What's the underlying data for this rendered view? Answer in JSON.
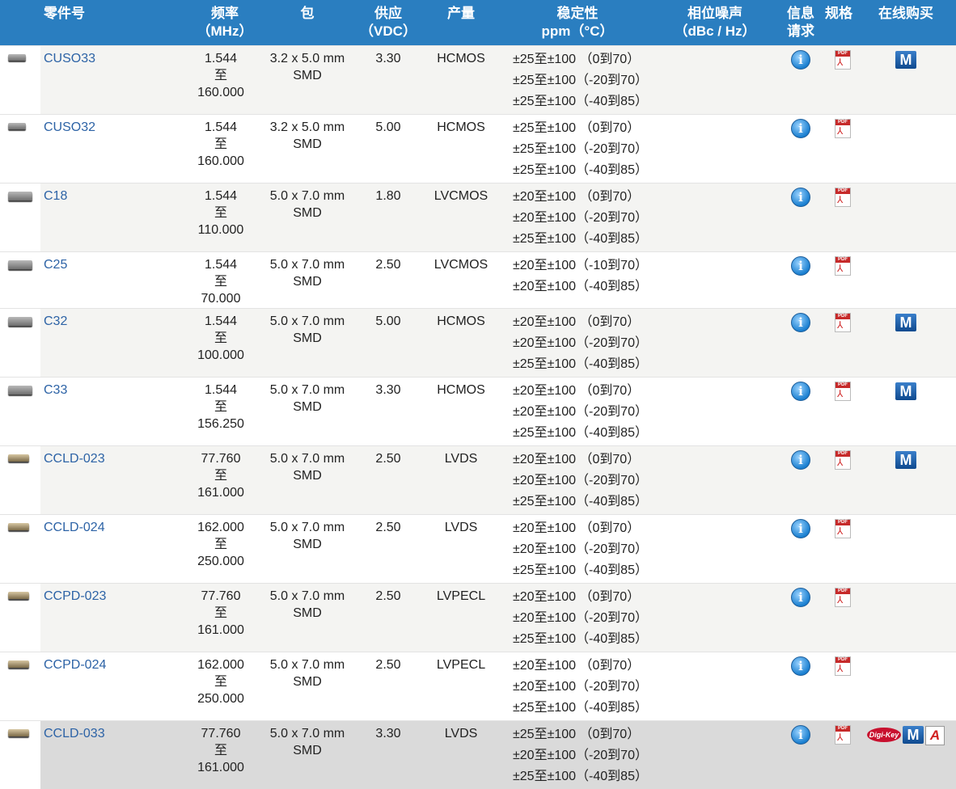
{
  "headers": {
    "part": "零件号",
    "freq_l1": "频率",
    "freq_l2": "（MHz）",
    "package": "包",
    "supply_l1": "供应",
    "supply_l2": "（VDC）",
    "output": "产量",
    "stab_l1": "稳定性",
    "stab_l2": "ppm（°C）",
    "noise_l1": "相位噪声",
    "noise_l2": "（dBc / Hz）",
    "info_l1": "信息",
    "info_l2": "请求",
    "spec": "规格",
    "buy": "在线购买"
  },
  "icons": {
    "info": "info-icon",
    "pdf": "pdf-icon",
    "mouser": "mouser-logo",
    "digikey": "digikey-logo",
    "arrow": "arrow-logo"
  },
  "labels": {
    "info_glyph": "i",
    "pdf_band": "PDF",
    "mouser_glyph": "M",
    "digikey_text": "Digi-Key",
    "arrow_glyph": "A"
  },
  "colors": {
    "header_bg": "#2a7ec0",
    "link": "#2d63a6",
    "row_shade": "#f4f4f2",
    "row_highlight": "#dadada"
  },
  "rows": [
    {
      "part": "CUSO33",
      "freq": [
        "1.544",
        "至",
        "160.000"
      ],
      "package": [
        "3.2 x 5.0 mm",
        "SMD"
      ],
      "supply": "3.30",
      "output": "HCMOS",
      "stability": [
        "±25至±100 （0到70）",
        "±25至±100（-20到70）",
        "±25至±100（-40到85）"
      ],
      "buy": [
        "mouser"
      ]
    },
    {
      "part": "CUSO32",
      "freq": [
        "1.544",
        "至",
        "160.000"
      ],
      "package": [
        "3.2 x 5.0 mm",
        "SMD"
      ],
      "supply": "5.00",
      "output": "HCMOS",
      "stability": [
        "±25至±100 （0到70）",
        "±25至±100（-20到70）",
        "±25至±100（-40到85）"
      ],
      "buy": []
    },
    {
      "part": "C18",
      "freq": [
        "1.544",
        "至",
        "110.000"
      ],
      "package": [
        "5.0 x 7.0 mm",
        "SMD"
      ],
      "supply": "1.80",
      "output": "LVCMOS",
      "stability": [
        "±20至±100 （0到70）",
        "±20至±100（-20到70）",
        "±25至±100（-40到85）"
      ],
      "buy": []
    },
    {
      "part": "C25",
      "freq": [
        "1.544",
        "至",
        "70.000"
      ],
      "package": [
        "5.0 x 7.0 mm",
        "SMD"
      ],
      "supply": "2.50",
      "output": "LVCMOS",
      "stability": [
        "±20至±100（-10到70）",
        "±20至±100（-40到85）"
      ],
      "buy": []
    },
    {
      "part": "C32",
      "freq": [
        "1.544",
        "至",
        "100.000"
      ],
      "package": [
        "5.0 x 7.0 mm",
        "SMD"
      ],
      "supply": "5.00",
      "output": "HCMOS",
      "stability": [
        "±20至±100 （0到70）",
        "±20至±100（-20到70）",
        "±25至±100（-40到85）"
      ],
      "buy": [
        "mouser"
      ]
    },
    {
      "part": "C33",
      "freq": [
        "1.544",
        "至",
        "156.250"
      ],
      "package": [
        "5.0 x 7.0 mm",
        "SMD"
      ],
      "supply": "3.30",
      "output": "HCMOS",
      "stability": [
        "±20至±100 （0到70）",
        "±20至±100（-20到70）",
        "±25至±100（-40到85）"
      ],
      "buy": [
        "mouser"
      ]
    },
    {
      "part": "CCLD-023",
      "freq": [
        "77.760",
        "至",
        "161.000"
      ],
      "package": [
        "5.0 x 7.0 mm",
        "SMD"
      ],
      "supply": "2.50",
      "output": "LVDS",
      "stability": [
        "±20至±100 （0到70）",
        "±20至±100（-20到70）",
        "±25至±100（-40到85）"
      ],
      "buy": [
        "mouser"
      ]
    },
    {
      "part": "CCLD-024",
      "freq": [
        "162.000",
        "至",
        "250.000"
      ],
      "package": [
        "5.0 x 7.0 mm",
        "SMD"
      ],
      "supply": "2.50",
      "output": "LVDS",
      "stability": [
        "±20至±100 （0到70）",
        "±20至±100（-20到70）",
        "±25至±100（-40到85）"
      ],
      "buy": []
    },
    {
      "part": "CCPD-023",
      "freq": [
        "77.760",
        "至",
        "161.000"
      ],
      "package": [
        "5.0 x 7.0 mm",
        "SMD"
      ],
      "supply": "2.50",
      "output": "LVPECL",
      "stability": [
        "±20至±100 （0到70）",
        "±20至±100（-20到70）",
        "±25至±100（-40到85）"
      ],
      "buy": []
    },
    {
      "part": "CCPD-024",
      "freq": [
        "162.000",
        "至",
        "250.000"
      ],
      "package": [
        "5.0 x 7.0 mm",
        "SMD"
      ],
      "supply": "2.50",
      "output": "LVPECL",
      "stability": [
        "±20至±100 （0到70）",
        "±20至±100（-20到70）",
        "±25至±100（-40到85）"
      ],
      "buy": []
    },
    {
      "part": "CCLD-033",
      "freq": [
        "77.760",
        "至",
        "161.000"
      ],
      "package": [
        "5.0 x 7.0 mm",
        "SMD"
      ],
      "supply": "3.30",
      "output": "LVDS",
      "stability": [
        "±25至±100 （0到70）",
        "±20至±100（-20到70）",
        "±25至±100（-40到85）"
      ],
      "buy": [
        "digikey",
        "mouser",
        "arrow"
      ]
    }
  ]
}
